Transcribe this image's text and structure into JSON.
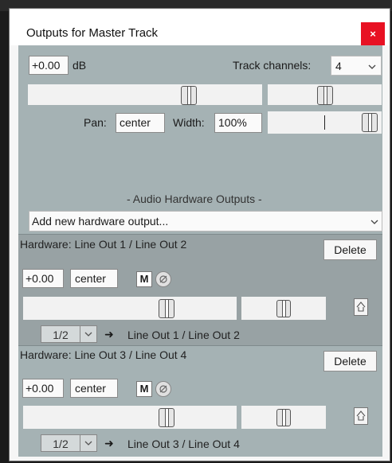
{
  "window": {
    "title": "Outputs for Master Track",
    "close_glyph": "×"
  },
  "master": {
    "volume": "+0.00",
    "volume_unit": "dB",
    "track_channels_label": "Track channels:",
    "track_channels_value": "4",
    "pan_label": "Pan:",
    "pan_value": "center",
    "width_label": "Width:",
    "width_value": "100%"
  },
  "audio_hw": {
    "section_label": "- Audio Hardware Outputs -",
    "add_output": "Add new hardware output..."
  },
  "outputs": [
    {
      "label": "Hardware: Line Out 1 / Line Out 2",
      "delete": "Delete",
      "volume": "+0.00",
      "pan": "center",
      "mute": "M",
      "channel": "1/2",
      "arrow": "➜",
      "destination": "Line Out 1 / Line Out 2"
    },
    {
      "label": "Hardware: Line Out 3 / Line Out 4",
      "delete": "Delete",
      "volume": "+0.00",
      "pan": "center",
      "mute": "M",
      "channel": "1/2",
      "arrow": "➜",
      "destination": "Line Out 3 / Line Out 4"
    }
  ]
}
